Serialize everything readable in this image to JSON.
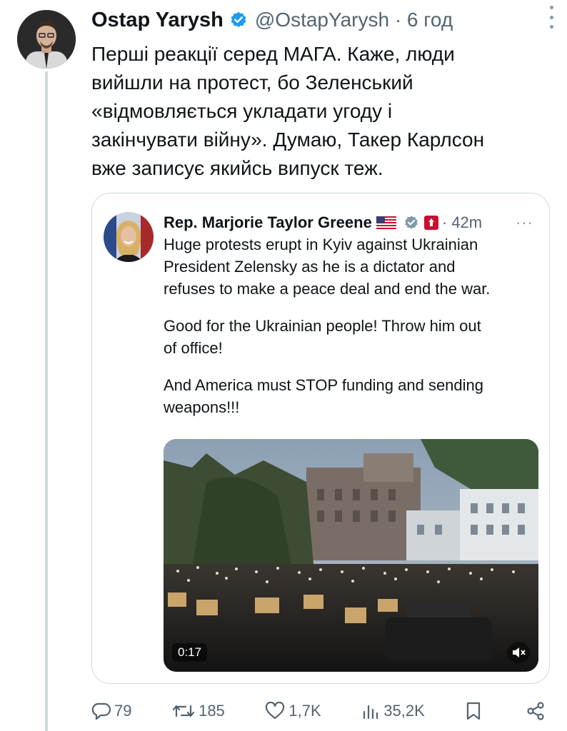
{
  "tweet": {
    "author_name": "Ostap Yarysh",
    "handle": "@OstapYarysh · 6 год",
    "text_lines": [
      "Перші реакції серед МАГА. Каже, люди",
      "вийшли на протест, бо Зеленський",
      "«відмовляється укладати угоду і",
      "закінчувати війну». Думаю, Такер Карлсон",
      "вже записує якийсь випуск теж."
    ]
  },
  "quote": {
    "author_name": "Rep. Marjorie Taylor Greene",
    "time": "· 42m",
    "more": "···",
    "paragraphs": [
      [
        "Huge protests erupt in Kyiv against Ukrainian",
        "President Zelensky as he is a dictator and",
        "refuses to make a peace deal and end the war."
      ],
      [
        "Good for the Ukrainian people! Throw him out",
        "of office!"
      ],
      [
        "And America must STOP funding and sending",
        "weapons!!!"
      ]
    ],
    "media": {
      "duration": "0:17"
    }
  },
  "actions": {
    "replies": "79",
    "reposts": "185",
    "likes": "1,7K",
    "views": "35,2K"
  },
  "colors": {
    "verified_blue": "#1d9bf0",
    "text": "#0f1419",
    "secondary": "#536471",
    "border": "#cfd9de"
  }
}
